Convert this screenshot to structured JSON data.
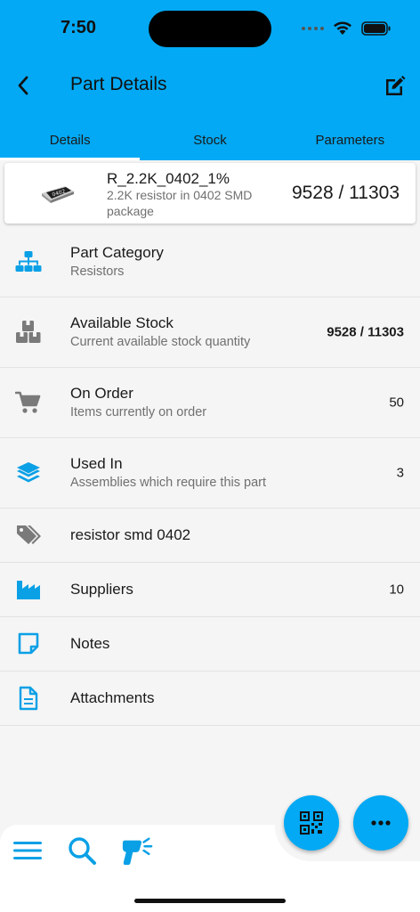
{
  "status_bar": {
    "time": "7:50"
  },
  "appbar": {
    "title": "Part Details"
  },
  "tabs": [
    {
      "label": "Details",
      "active": true
    },
    {
      "label": "Stock",
      "active": false
    },
    {
      "label": "Parameters",
      "active": false
    }
  ],
  "part": {
    "name": "R_2.2K_0402_1%",
    "description": "2.2K resistor in 0402 SMD package",
    "stock": "9528 / 11303",
    "thumb_marking": "0402"
  },
  "rows": [
    {
      "icon": "sitemap-icon",
      "title": "Part Category",
      "subtitle": "Resistors",
      "trailing": ""
    },
    {
      "icon": "boxes-icon",
      "title": "Available Stock",
      "subtitle": "Current available stock quantity",
      "trailing": "9528 / 11303"
    },
    {
      "icon": "cart-icon",
      "title": "On Order",
      "subtitle": "Items currently on order",
      "trailing": "50"
    },
    {
      "icon": "layers-icon",
      "title": "Used In",
      "subtitle": "Assemblies which require this part",
      "trailing": "3"
    },
    {
      "icon": "tags-icon",
      "title": "resistor smd 0402",
      "subtitle": "",
      "trailing": ""
    },
    {
      "icon": "industry-icon",
      "title": "Suppliers",
      "subtitle": "",
      "trailing": "10"
    },
    {
      "icon": "note-icon",
      "title": "Notes",
      "subtitle": "",
      "trailing": ""
    },
    {
      "icon": "file-icon",
      "title": "Attachments",
      "subtitle": "",
      "trailing": ""
    }
  ],
  "colors": {
    "accent": "#03a9f4",
    "icon_blue": "#0aa0e6",
    "icon_grey": "#7a7a7a"
  }
}
